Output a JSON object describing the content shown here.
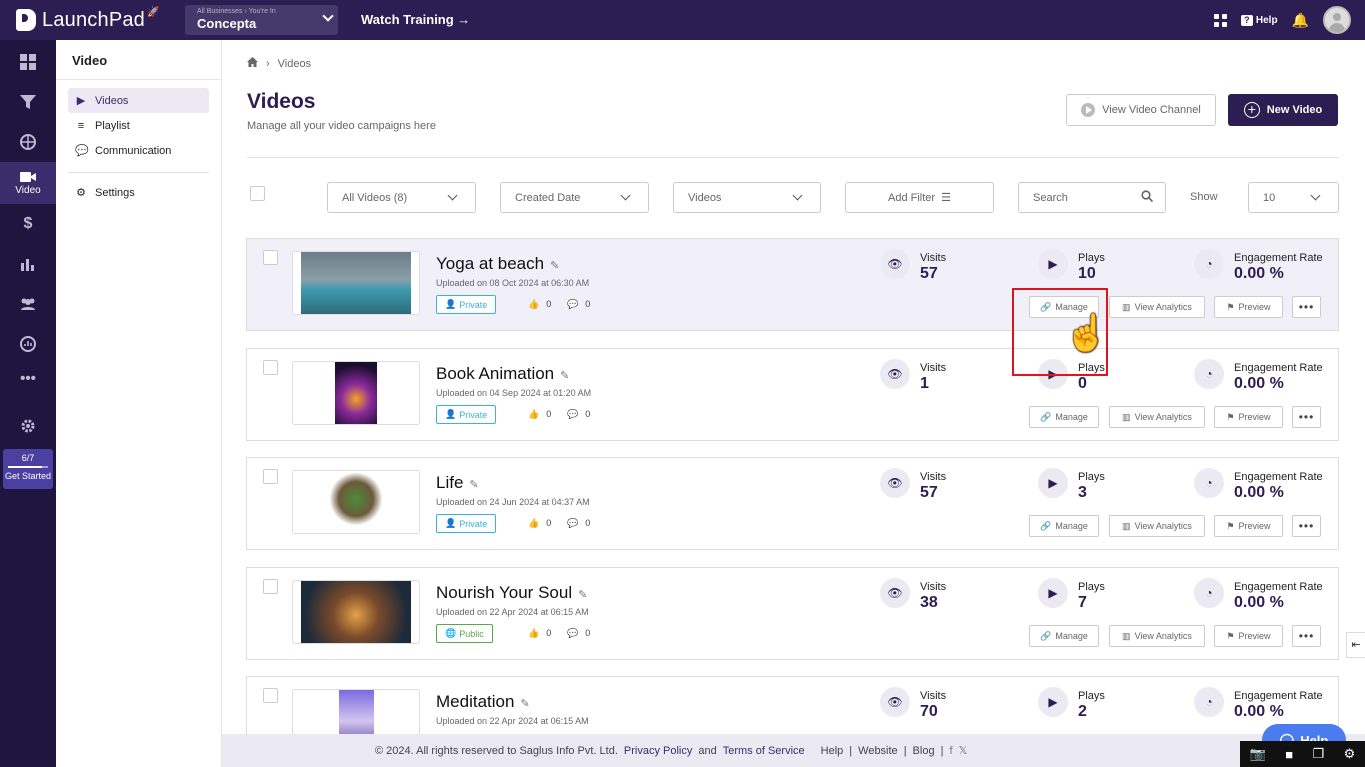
{
  "topbar": {
    "app_name": "LaunchPad",
    "business_caption": "All Businesses › You're In",
    "business_name": "Concepta",
    "watch_training": "Watch Training →",
    "help_label": "Help"
  },
  "rail": {
    "active_label": "Video",
    "get_started_progress": "6/7",
    "get_started_label": "Get Started"
  },
  "sidebar": {
    "title": "Video",
    "items": [
      {
        "label": "Videos",
        "icon": "video-icon"
      },
      {
        "label": "Playlist",
        "icon": "playlist-icon"
      },
      {
        "label": "Communication",
        "icon": "chat-icon"
      },
      {
        "label": "Settings",
        "icon": "gear-icon"
      }
    ]
  },
  "breadcrumb": {
    "current": "Videos"
  },
  "page": {
    "title": "Videos",
    "subtitle": "Manage all your video campaigns here",
    "view_channel": "View Video Channel",
    "new_video": "New Video"
  },
  "filters": {
    "all_videos": "All Videos (8)",
    "created_date": "Created Date",
    "videos": "Videos",
    "add_filter": "Add Filter",
    "search_placeholder": "Search",
    "show_label": "Show",
    "show_value": "10"
  },
  "labels": {
    "visits": "Visits",
    "plays": "Plays",
    "engagement": "Engagement Rate",
    "manage": "Manage",
    "analytics": "View Analytics",
    "preview": "Preview"
  },
  "videos": [
    {
      "title": "Yoga at beach",
      "uploaded": "Uploaded on 08 Oct 2024 at 06:30 AM",
      "privacy": "Private",
      "likes": "0",
      "comments": "0",
      "visits": "57",
      "plays": "10",
      "engagement": "0.00 %"
    },
    {
      "title": "Book Animation",
      "uploaded": "Uploaded on 04 Sep 2024 at 01:20 AM",
      "privacy": "Private",
      "likes": "0",
      "comments": "0",
      "visits": "1",
      "plays": "0",
      "engagement": "0.00 %"
    },
    {
      "title": "Life",
      "uploaded": "Uploaded on 24 Jun 2024 at 04:37 AM",
      "privacy": "Private",
      "likes": "0",
      "comments": "0",
      "visits": "57",
      "plays": "3",
      "engagement": "0.00 %"
    },
    {
      "title": "Nourish Your Soul",
      "uploaded": "Uploaded on 22 Apr 2024 at 06:15 AM",
      "privacy": "Public",
      "likes": "0",
      "comments": "0",
      "visits": "38",
      "plays": "7",
      "engagement": "0.00 %"
    },
    {
      "title": "Meditation",
      "uploaded": "Uploaded on 22 Apr 2024 at 06:15 AM",
      "privacy": "",
      "likes": "",
      "comments": "",
      "visits": "70",
      "plays": "2",
      "engagement": "0.00 %"
    }
  ],
  "footer": {
    "copyright": "© 2024. All rights reserved to Saglus Info Pvt. Ltd.",
    "privacy": "Privacy Policy",
    "and": "and",
    "terms": "Terms of Service",
    "help": "Help",
    "website": "Website",
    "blog": "Blog"
  },
  "help_fab": "Help",
  "colors": {
    "brand": "#2c1e52",
    "highlight": "#e0141c"
  }
}
